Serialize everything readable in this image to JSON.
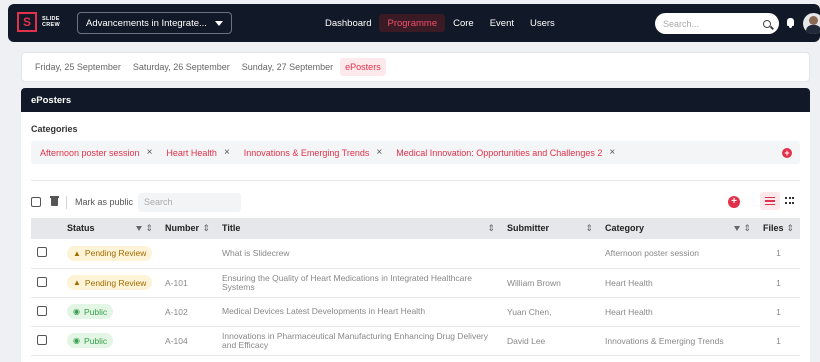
{
  "brand": {
    "logo_letter": "S",
    "logo_line1": "SLIDE",
    "logo_line2": "CREW"
  },
  "event_selector": {
    "value": "Advancements in Integrate..."
  },
  "nav": [
    {
      "label": "Dashboard",
      "active": false
    },
    {
      "label": "Programme",
      "active": true
    },
    {
      "label": "Core",
      "active": false
    },
    {
      "label": "Event",
      "active": false
    },
    {
      "label": "Users",
      "active": false
    }
  ],
  "search": {
    "placeholder": "Search..."
  },
  "day_tabs": [
    {
      "label": "Friday, 25 September",
      "active": false
    },
    {
      "label": "Saturday, 26 September",
      "active": false
    },
    {
      "label": "Sunday, 27 September",
      "active": false
    },
    {
      "label": "ePosters",
      "active": true
    }
  ],
  "panel": {
    "title": "ePosters",
    "categories_label": "Categories",
    "categories": [
      "Afternoon poster session",
      "Heart Health",
      "Innovations & Emerging Trends",
      "Medical Innovation: Opportunities and Challenges 2"
    ],
    "chip_remove_glyph": "×",
    "add_glyph": "+"
  },
  "toolbar": {
    "mark_public_label": "Mark as public",
    "search_placeholder": "Search"
  },
  "table": {
    "headers": {
      "status": "Status",
      "number": "Number",
      "title": "Title",
      "submitter": "Submitter",
      "category": "Category",
      "files": "Files"
    },
    "sort_glyph": "⇕",
    "rows": [
      {
        "status": "Pending Review",
        "status_type": "pending",
        "number": "",
        "title": "What is Slidecrew",
        "submitter": "",
        "category": "Afternoon poster session",
        "files": "1"
      },
      {
        "status": "Pending Review",
        "status_type": "pending",
        "number": "A-101",
        "title": "Ensuring the Quality of Heart Medications in Integrated Healthcare Systems",
        "submitter": "William Brown",
        "category": "Heart Health",
        "files": "1"
      },
      {
        "status": "Public",
        "status_type": "public",
        "number": "A-102",
        "title": "Medical Devices Latest Developments in Heart Health",
        "submitter": "Yuan Chen,",
        "category": "Heart Health",
        "files": "1"
      },
      {
        "status": "Public",
        "status_type": "public",
        "number": "A-104",
        "title": "Innovations in Pharmaceutical Manufacturing Enhancing Drug Delivery and Efficacy",
        "submitter": "David Lee",
        "category": "Innovations & Emerging Trends",
        "files": "1"
      }
    ]
  },
  "colors": {
    "accent": "#e2314a",
    "dark": "#111827",
    "pending": "#a36b00",
    "public": "#35a04a"
  }
}
